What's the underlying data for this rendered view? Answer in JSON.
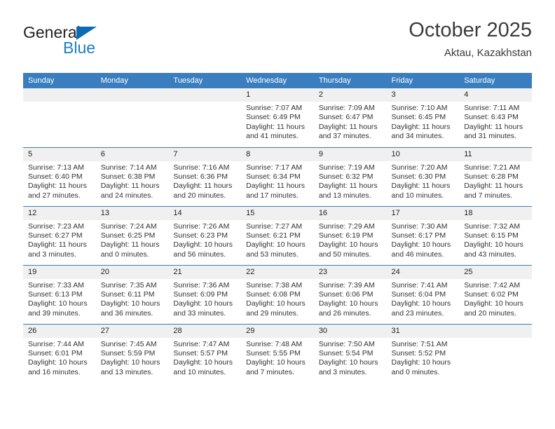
{
  "logo": {
    "word_one": "General",
    "word_two": "Blue",
    "triangle_color": "#0b6cb5",
    "blue_color": "#1a7ec8"
  },
  "header": {
    "title": "October 2025",
    "subtitle": "Aktau, Kazakhstan"
  },
  "theme": {
    "header_bg": "#3a7ebf",
    "daynum_bg": "#f0f0f0",
    "grid_line": "#3a7ebf"
  },
  "weekday_headers": [
    "Sunday",
    "Monday",
    "Tuesday",
    "Wednesday",
    "Thursday",
    "Friday",
    "Saturday"
  ],
  "weeks": [
    [
      {
        "day": "",
        "sunrise": "",
        "sunset": "",
        "daylight": "",
        "daylight2": ""
      },
      {
        "day": "",
        "sunrise": "",
        "sunset": "",
        "daylight": "",
        "daylight2": ""
      },
      {
        "day": "",
        "sunrise": "",
        "sunset": "",
        "daylight": "",
        "daylight2": ""
      },
      {
        "day": "1",
        "sunrise": "Sunrise: 7:07 AM",
        "sunset": "Sunset: 6:49 PM",
        "daylight": "Daylight: 11 hours",
        "daylight2": "and 41 minutes."
      },
      {
        "day": "2",
        "sunrise": "Sunrise: 7:09 AM",
        "sunset": "Sunset: 6:47 PM",
        "daylight": "Daylight: 11 hours",
        "daylight2": "and 37 minutes."
      },
      {
        "day": "3",
        "sunrise": "Sunrise: 7:10 AM",
        "sunset": "Sunset: 6:45 PM",
        "daylight": "Daylight: 11 hours",
        "daylight2": "and 34 minutes."
      },
      {
        "day": "4",
        "sunrise": "Sunrise: 7:11 AM",
        "sunset": "Sunset: 6:43 PM",
        "daylight": "Daylight: 11 hours",
        "daylight2": "and 31 minutes."
      }
    ],
    [
      {
        "day": "5",
        "sunrise": "Sunrise: 7:13 AM",
        "sunset": "Sunset: 6:40 PM",
        "daylight": "Daylight: 11 hours",
        "daylight2": "and 27 minutes."
      },
      {
        "day": "6",
        "sunrise": "Sunrise: 7:14 AM",
        "sunset": "Sunset: 6:38 PM",
        "daylight": "Daylight: 11 hours",
        "daylight2": "and 24 minutes."
      },
      {
        "day": "7",
        "sunrise": "Sunrise: 7:16 AM",
        "sunset": "Sunset: 6:36 PM",
        "daylight": "Daylight: 11 hours",
        "daylight2": "and 20 minutes."
      },
      {
        "day": "8",
        "sunrise": "Sunrise: 7:17 AM",
        "sunset": "Sunset: 6:34 PM",
        "daylight": "Daylight: 11 hours",
        "daylight2": "and 17 minutes."
      },
      {
        "day": "9",
        "sunrise": "Sunrise: 7:19 AM",
        "sunset": "Sunset: 6:32 PM",
        "daylight": "Daylight: 11 hours",
        "daylight2": "and 13 minutes."
      },
      {
        "day": "10",
        "sunrise": "Sunrise: 7:20 AM",
        "sunset": "Sunset: 6:30 PM",
        "daylight": "Daylight: 11 hours",
        "daylight2": "and 10 minutes."
      },
      {
        "day": "11",
        "sunrise": "Sunrise: 7:21 AM",
        "sunset": "Sunset: 6:28 PM",
        "daylight": "Daylight: 11 hours",
        "daylight2": "and 7 minutes."
      }
    ],
    [
      {
        "day": "12",
        "sunrise": "Sunrise: 7:23 AM",
        "sunset": "Sunset: 6:27 PM",
        "daylight": "Daylight: 11 hours",
        "daylight2": "and 3 minutes."
      },
      {
        "day": "13",
        "sunrise": "Sunrise: 7:24 AM",
        "sunset": "Sunset: 6:25 PM",
        "daylight": "Daylight: 11 hours",
        "daylight2": "and 0 minutes."
      },
      {
        "day": "14",
        "sunrise": "Sunrise: 7:26 AM",
        "sunset": "Sunset: 6:23 PM",
        "daylight": "Daylight: 10 hours",
        "daylight2": "and 56 minutes."
      },
      {
        "day": "15",
        "sunrise": "Sunrise: 7:27 AM",
        "sunset": "Sunset: 6:21 PM",
        "daylight": "Daylight: 10 hours",
        "daylight2": "and 53 minutes."
      },
      {
        "day": "16",
        "sunrise": "Sunrise: 7:29 AM",
        "sunset": "Sunset: 6:19 PM",
        "daylight": "Daylight: 10 hours",
        "daylight2": "and 50 minutes."
      },
      {
        "day": "17",
        "sunrise": "Sunrise: 7:30 AM",
        "sunset": "Sunset: 6:17 PM",
        "daylight": "Daylight: 10 hours",
        "daylight2": "and 46 minutes."
      },
      {
        "day": "18",
        "sunrise": "Sunrise: 7:32 AM",
        "sunset": "Sunset: 6:15 PM",
        "daylight": "Daylight: 10 hours",
        "daylight2": "and 43 minutes."
      }
    ],
    [
      {
        "day": "19",
        "sunrise": "Sunrise: 7:33 AM",
        "sunset": "Sunset: 6:13 PM",
        "daylight": "Daylight: 10 hours",
        "daylight2": "and 39 minutes."
      },
      {
        "day": "20",
        "sunrise": "Sunrise: 7:35 AM",
        "sunset": "Sunset: 6:11 PM",
        "daylight": "Daylight: 10 hours",
        "daylight2": "and 36 minutes."
      },
      {
        "day": "21",
        "sunrise": "Sunrise: 7:36 AM",
        "sunset": "Sunset: 6:09 PM",
        "daylight": "Daylight: 10 hours",
        "daylight2": "and 33 minutes."
      },
      {
        "day": "22",
        "sunrise": "Sunrise: 7:38 AM",
        "sunset": "Sunset: 6:08 PM",
        "daylight": "Daylight: 10 hours",
        "daylight2": "and 29 minutes."
      },
      {
        "day": "23",
        "sunrise": "Sunrise: 7:39 AM",
        "sunset": "Sunset: 6:06 PM",
        "daylight": "Daylight: 10 hours",
        "daylight2": "and 26 minutes."
      },
      {
        "day": "24",
        "sunrise": "Sunrise: 7:41 AM",
        "sunset": "Sunset: 6:04 PM",
        "daylight": "Daylight: 10 hours",
        "daylight2": "and 23 minutes."
      },
      {
        "day": "25",
        "sunrise": "Sunrise: 7:42 AM",
        "sunset": "Sunset: 6:02 PM",
        "daylight": "Daylight: 10 hours",
        "daylight2": "and 20 minutes."
      }
    ],
    [
      {
        "day": "26",
        "sunrise": "Sunrise: 7:44 AM",
        "sunset": "Sunset: 6:01 PM",
        "daylight": "Daylight: 10 hours",
        "daylight2": "and 16 minutes."
      },
      {
        "day": "27",
        "sunrise": "Sunrise: 7:45 AM",
        "sunset": "Sunset: 5:59 PM",
        "daylight": "Daylight: 10 hours",
        "daylight2": "and 13 minutes."
      },
      {
        "day": "28",
        "sunrise": "Sunrise: 7:47 AM",
        "sunset": "Sunset: 5:57 PM",
        "daylight": "Daylight: 10 hours",
        "daylight2": "and 10 minutes."
      },
      {
        "day": "29",
        "sunrise": "Sunrise: 7:48 AM",
        "sunset": "Sunset: 5:55 PM",
        "daylight": "Daylight: 10 hours",
        "daylight2": "and 7 minutes."
      },
      {
        "day": "30",
        "sunrise": "Sunrise: 7:50 AM",
        "sunset": "Sunset: 5:54 PM",
        "daylight": "Daylight: 10 hours",
        "daylight2": "and 3 minutes."
      },
      {
        "day": "31",
        "sunrise": "Sunrise: 7:51 AM",
        "sunset": "Sunset: 5:52 PM",
        "daylight": "Daylight: 10 hours",
        "daylight2": "and 0 minutes."
      },
      {
        "day": "",
        "sunrise": "",
        "sunset": "",
        "daylight": "",
        "daylight2": ""
      }
    ]
  ]
}
